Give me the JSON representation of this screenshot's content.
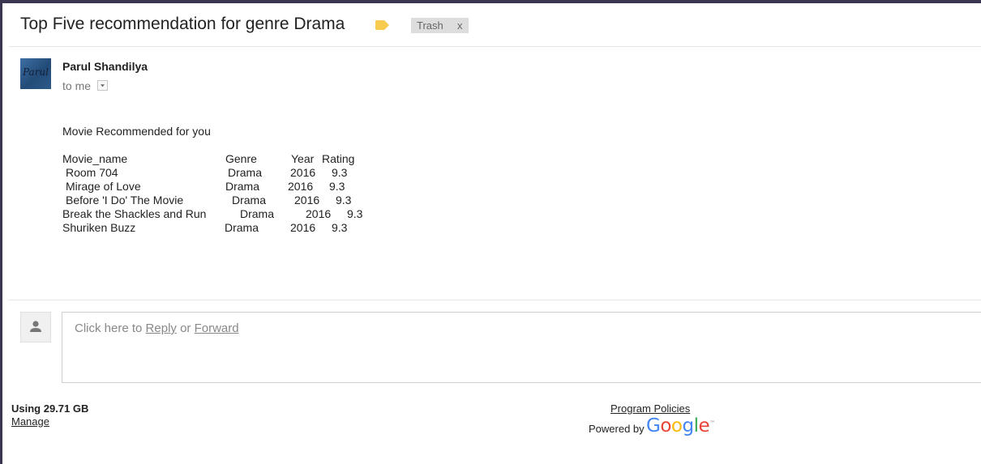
{
  "subject": "Top Five recommendation for genre Drama",
  "tags": {
    "trash_label": "Trash",
    "remove_label": "x"
  },
  "sender": {
    "name": "Parul Shandilya",
    "avatar_text": "Parul",
    "recipient": "to me"
  },
  "body": {
    "intro": "Movie Recommended for you",
    "headers": [
      "Movie_name",
      "Genre",
      "Year",
      "Rating"
    ],
    "rows": [
      [
        "Room 704",
        "Drama",
        "2016",
        "9.3"
      ],
      [
        "Mirage of Love",
        "Drama",
        "2016",
        "9.3"
      ],
      [
        "Before 'I Do' The Movie",
        "Drama",
        "2016",
        "9.3"
      ],
      [
        "Break the Shackles and Run",
        "Drama",
        "2016",
        "9.3"
      ],
      [
        "Shuriken Buzz",
        "Drama",
        "2016",
        "9.3"
      ]
    ]
  },
  "reply": {
    "prefix": "Click here to ",
    "reply_link": "Reply",
    "or": " or ",
    "forward_link": "Forward"
  },
  "footer": {
    "storage": "Using 29.71 GB",
    "manage": "Manage",
    "policies": "Program Policies",
    "powered_by": "Powered by",
    "google": [
      "G",
      "o",
      "o",
      "g",
      "l",
      "e"
    ],
    "google_tm": "™"
  },
  "colors": {
    "label_tag": "#f7cb4d",
    "google": [
      "#4285F4",
      "#EA4335",
      "#FBBC05",
      "#4285F4",
      "#34A853",
      "#EA4335"
    ]
  }
}
